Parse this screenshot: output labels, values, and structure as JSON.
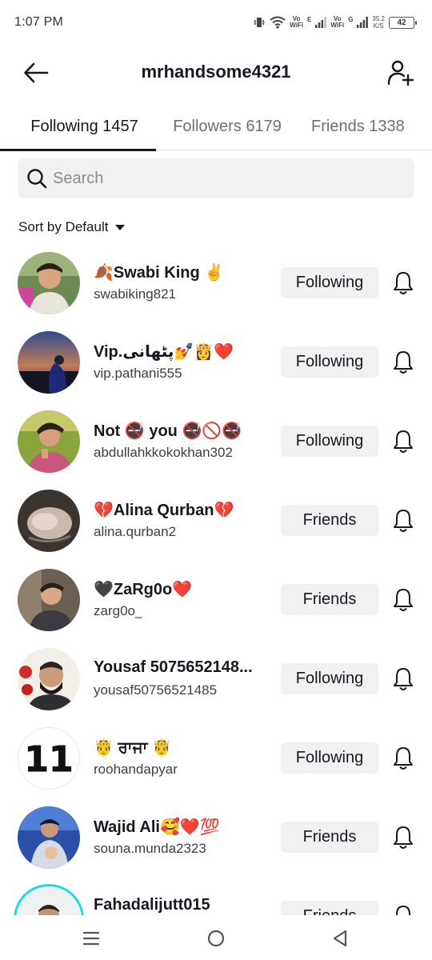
{
  "status_bar": {
    "time": "1:07 PM",
    "vo_label_1": "Vo",
    "wifi_label_1": "WiFi",
    "net_1": "E",
    "vo_label_2": "Vo",
    "wifi_label_2": "WiFi",
    "net_2": "G",
    "speed_value": "35.2",
    "speed_unit": "K/S",
    "battery": "42"
  },
  "header": {
    "title": "mrhandsome4321",
    "back_icon": "arrow-left-icon",
    "add_icon": "add-user-icon"
  },
  "tabs": [
    {
      "label": "Following 1457",
      "active": true
    },
    {
      "label": "Followers 6179",
      "active": false
    },
    {
      "label": "Friends 1338",
      "active": false
    }
  ],
  "search": {
    "placeholder": "Search",
    "value": ""
  },
  "sort": {
    "label": "Sort by Default"
  },
  "accounts": [
    {
      "name": "🍂Swabi King ✌️",
      "handle": "swabiking821",
      "button": "Following"
    },
    {
      "name": "Vip.پٹھانی💅👸❤️",
      "handle": "vip.pathani555",
      "button": "Following"
    },
    {
      "name": "Not 🚭 you 🚭🚫🚭",
      "handle": "abdullahkkokokhan302",
      "button": "Following"
    },
    {
      "name": "💔Alina Qurban💔",
      "handle": "alina.qurban2",
      "button": "Friends"
    },
    {
      "name": "🖤ZaRg0o❤️",
      "handle": "zarg0o_",
      "button": "Friends"
    },
    {
      "name": "Yousaf 5075652148...",
      "handle": "yousaf50756521485",
      "button": "Following"
    },
    {
      "name": "🤴 ਰਾਜਾ 🤴",
      "handle": "roohandapyar",
      "button": "Following"
    },
    {
      "name": "Wajid Ali🥰❤️💯",
      "handle": "souna.munda2323",
      "button": "Friends"
    },
    {
      "name": "Fahadalijutt015",
      "handle": "",
      "button": "Friends"
    }
  ],
  "avatar_badge_text": "11",
  "colors": {
    "text_primary": "#161823",
    "text_secondary": "#6e6f75",
    "button_bg": "#f1f1f2",
    "story_ring": "#20d5ec"
  }
}
